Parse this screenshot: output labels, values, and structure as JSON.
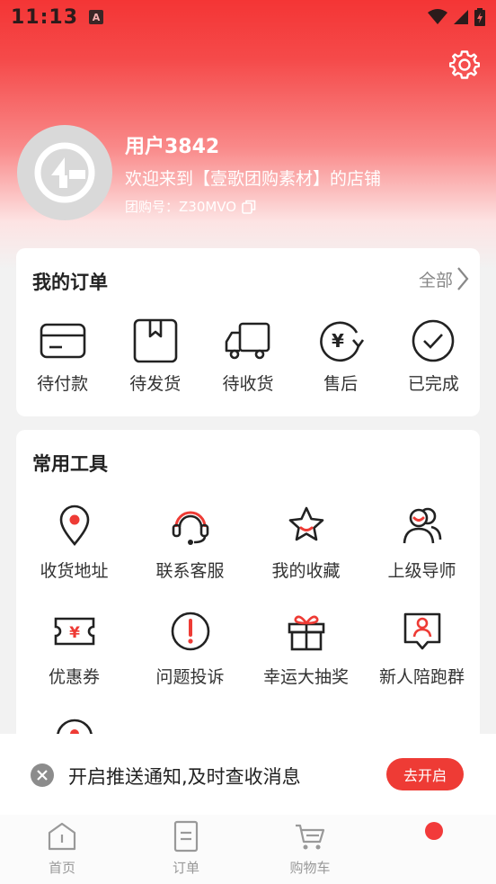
{
  "status_bar": {
    "time": "11:13",
    "app_badge": "A"
  },
  "profile": {
    "name": "用户3842",
    "welcome": "欢迎来到【壹歌团购素材】的店铺",
    "group_id": "团购号：Z30MVO"
  },
  "orders": {
    "title": "我的订单",
    "see_all": "全部",
    "items": [
      {
        "label": "待付款",
        "icon": "card-icon"
      },
      {
        "label": "待发货",
        "icon": "package-icon"
      },
      {
        "label": "待收货",
        "icon": "truck-icon"
      },
      {
        "label": "售后",
        "icon": "refund-icon"
      },
      {
        "label": "已完成",
        "icon": "check-circle-icon"
      }
    ]
  },
  "tools": {
    "title": "常用工具",
    "items": [
      {
        "label": "收货地址",
        "icon": "location-pin-icon"
      },
      {
        "label": "联系客服",
        "icon": "headset-icon"
      },
      {
        "label": "我的收藏",
        "icon": "star-icon"
      },
      {
        "label": "上级导师",
        "icon": "mentor-icon"
      },
      {
        "label": "优惠券",
        "icon": "coupon-icon"
      },
      {
        "label": "问题投诉",
        "icon": "exclamation-icon"
      },
      {
        "label": "幸运大抽奖",
        "icon": "gift-icon"
      },
      {
        "label": "新人陪跑群",
        "icon": "group-chat-icon"
      }
    ]
  },
  "push_banner": {
    "text": "开启推送通知,及时查收消息",
    "button": "去开启"
  },
  "tabbar": {
    "items": [
      {
        "label": "首页",
        "icon": "home-icon"
      },
      {
        "label": "订单",
        "icon": "order-list-icon"
      },
      {
        "label": "购物车",
        "icon": "cart-icon"
      }
    ]
  },
  "colors": {
    "accent": "#ee3b35",
    "header_top": "#f43535"
  }
}
